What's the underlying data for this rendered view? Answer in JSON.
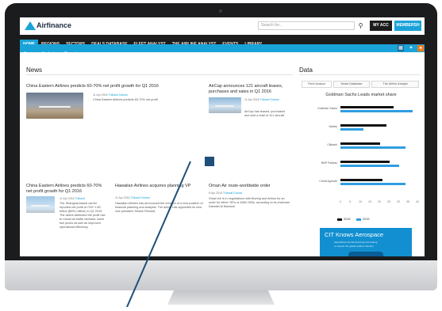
{
  "topbar": {
    "logo": "Airfinance",
    "search_placeholder": "Search for...",
    "search_icon": "search-icon",
    "my_account": "MY ACC",
    "membership": "MEMBERSH"
  },
  "nav": {
    "items": [
      "HOME",
      "REGIONS",
      "SECTORS",
      "DEALS DATABASE",
      "FLEET ANALYST",
      "THE AIRLINE ANALYST",
      "EVENTS",
      "LIBRARY"
    ]
  },
  "subnav": {
    "items": [
      "News",
      "Analysis",
      "Reports"
    ],
    "icons": [
      "calendar-icon",
      "twitter-icon",
      "rss-icon"
    ]
  },
  "news": {
    "heading": "News",
    "articles": [
      {
        "title": "China Eastern Airlines predicts 60-70% net profit growth for Q1 2016",
        "meta": "11 Apr 2016",
        "meta_link": "Thibault Dubois",
        "summary": "China Eastern Airlines predicts 60-70% net profit"
      },
      {
        "title": "AirCap announces 121 aircraft leases, purchases and sales in Q1 2016",
        "meta": "11 Apr 2016",
        "meta_link": "Thibault Dubois",
        "summary": "AirCap has leased, purchased and sold a total of 121 aircraft"
      },
      {
        "title": "China Eastern Airlines predicts 60-70% net profit growth for Q1 2016",
        "meta": "11 Apr 2016",
        "meta_link": "Thibault",
        "summary": "The Shanghai-based carrier reported net profit of CNY 1.89 billion ($291 million) in Q1 2015. The airline attributed the profit rise to robust air traffic demand, lower fuel prices as well as improved operational efficiency."
      },
      {
        "title": "Hawaiian Airlines acquires planning VP",
        "meta": "11 Apr 2016",
        "meta_link": "Thibault Dubois",
        "summary": "Hawaiian Airlines has announced the creation of a new position of financial planning and analysis. The airline has appointed its new vice president Shawn Richard."
      },
      {
        "title": "Oman Air route-worldwide order",
        "meta": "8 Apr 2016",
        "meta_link": "Thibault Dubois",
        "summary": "Oman Air is in negotiations with Boeing and Airbus for an order for either 787s or A350-900s, according to its chairman Darwish Al Barwani."
      }
    ]
  },
  "data_panel": {
    "heading": "Data",
    "tabs": [
      "Fleet Analyst",
      "Deals Database",
      "The Airline Analyst"
    ],
    "active_tab": "Fleet Analyst"
  },
  "chart_data": {
    "type": "bar",
    "title": "Goldman Sachs Leads market share",
    "categories": [
      "Goldman Sachs",
      "Natixis",
      "Citibank",
      "BNP Paribas",
      "Credit Agricole"
    ],
    "series": [
      {
        "name": "2016",
        "color": "#111111",
        "values": [
          28,
          24,
          21,
          26,
          22
        ]
      },
      {
        "name": "2015",
        "color": "#2f9ee0",
        "values": [
          38,
          12,
          34,
          31,
          34
        ]
      }
    ],
    "xlim": [
      0,
      40
    ],
    "xticks": [
      "0",
      "5",
      "10",
      "15",
      "20",
      "25",
      "30",
      "35",
      "40"
    ],
    "legend_position": "bottom"
  },
  "ad": {
    "title": "CIT Knows Aerospace",
    "lines": [
      "Specialized aircraft financing and leasing",
      "to support the global aviation industry"
    ]
  },
  "colors": {
    "brand": "#1aa3d8",
    "nav": "#1c1c1c",
    "bezel": "#1b1c1e",
    "cursor": "#1f4f7a"
  }
}
